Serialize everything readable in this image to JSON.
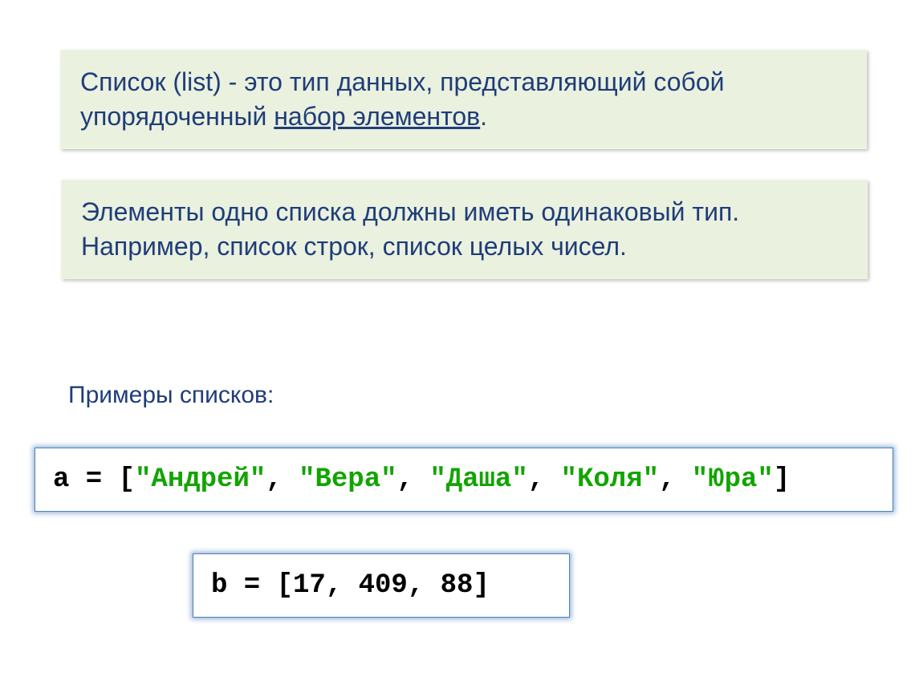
{
  "box1": {
    "part1": "Список (list) - это тип данных, представляющий собой упорядоченный ",
    "underlined": "набор элементов",
    "part2": "."
  },
  "box2": "Элементы одно списка должны иметь одинаковый тип. Например, список строк, список целых чисел.",
  "examples_label": "Примеры списков:",
  "code1": {
    "prefix": "a = [",
    "s1": "\"Андрей\"",
    "c1": ", ",
    "s2": "\"Вера\"",
    "c2": ", ",
    "s3": "\"Даша\"",
    "c3": ", ",
    "s4": "\"Коля\"",
    "c4": ", ",
    "s5": "\"Юра\"",
    "suffix": "]"
  },
  "code2": "b = [17, 409, 88]"
}
